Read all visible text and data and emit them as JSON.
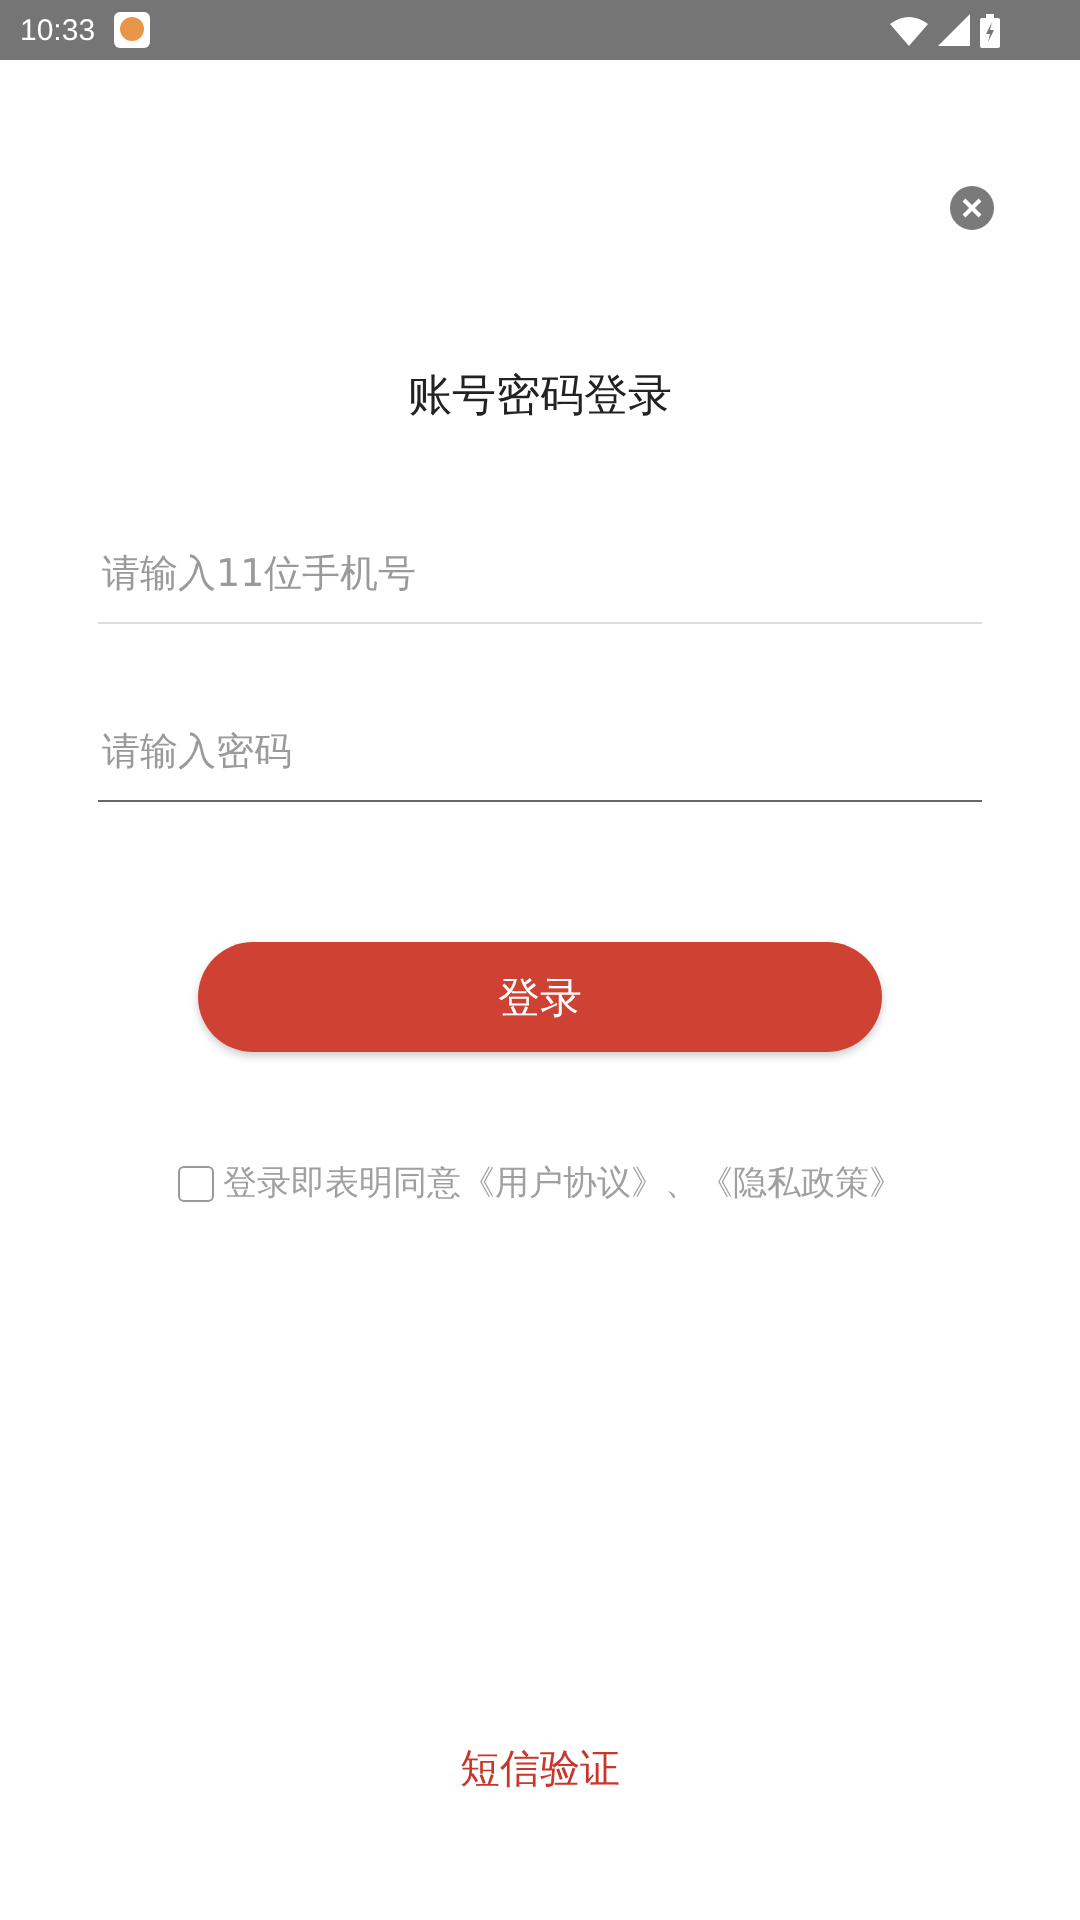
{
  "status_bar": {
    "time": "10:33"
  },
  "title": "账号密码登录",
  "fields": [
    {
      "placeholder": "请输入11位手机号",
      "focused": false
    },
    {
      "placeholder": "请输入密码",
      "focused": true
    }
  ],
  "login_button": "登录",
  "agreement": {
    "checked": false,
    "text": "登录即表明同意《用户协议》、《隐私政策》"
  },
  "sms_link": "短信验证"
}
